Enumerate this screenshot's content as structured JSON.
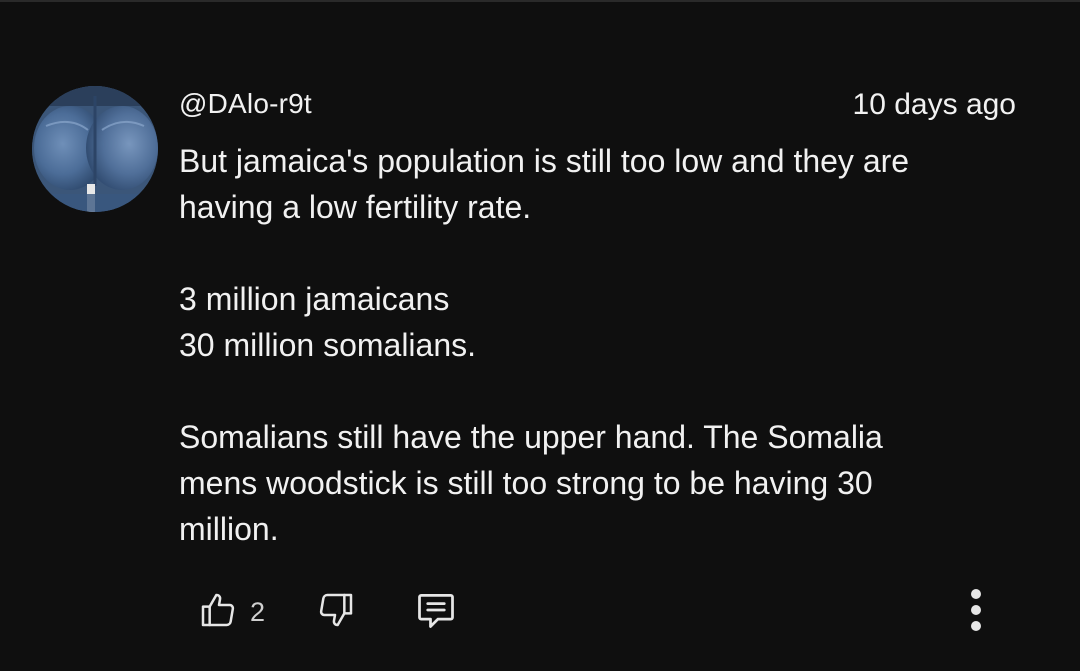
{
  "comment": {
    "author_handle": "@DAlo-r9t",
    "timestamp": "10 days ago",
    "paragraphs": [
      [
        "But jamaica's population is still too low and they are",
        "having a low fertility rate."
      ],
      [
        "3 million jamaicans",
        "30 million somalians."
      ],
      [
        "Somalians still have the upper hand. The Somalia",
        "mens woodstick is still too strong to be having 30",
        "million."
      ]
    ],
    "like_count": "2"
  },
  "icons": {
    "like": "thumbs-up-icon",
    "dislike": "thumbs-down-icon",
    "reply": "comment-icon",
    "more": "more-vertical-icon"
  },
  "colors": {
    "background": "#0f0f0f",
    "text": "#f1f1f1",
    "icon": "#e6e6e6"
  }
}
